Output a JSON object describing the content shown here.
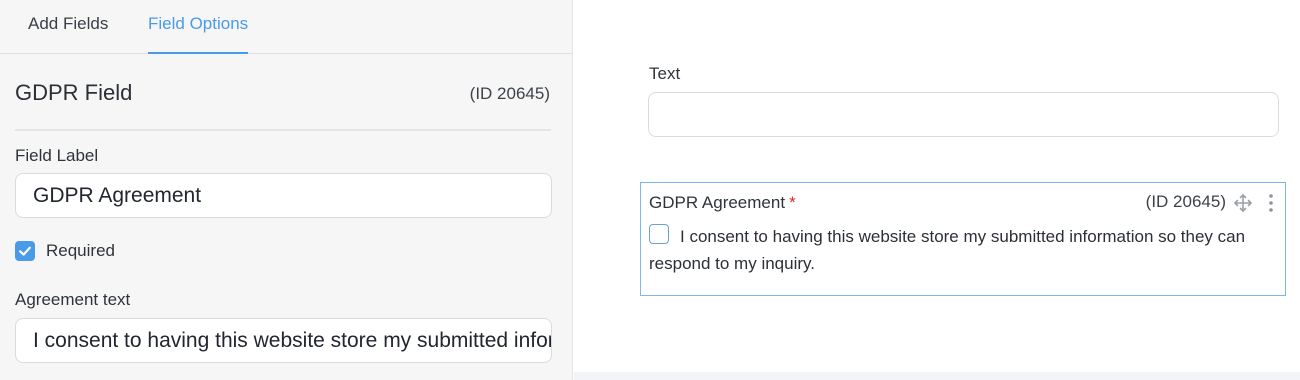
{
  "tabs": {
    "add_fields": "Add Fields",
    "field_options": "Field Options",
    "active_tab": "field_options"
  },
  "field_options": {
    "title": "GDPR Field",
    "id_text": "(ID 20645)",
    "field_label": {
      "label": "Field Label",
      "value": "GDPR Agreement"
    },
    "required": {
      "label": "Required",
      "checked": true
    },
    "agreement_text": {
      "label": "Agreement text",
      "value": "I consent to having this website store my submitted information so they can respond to my inquiry."
    }
  },
  "preview": {
    "text_field": {
      "label": "Text",
      "value": ""
    },
    "gdpr_field": {
      "label": "GDPR Agreement",
      "required_marker": "*",
      "id_text": "(ID 20645)",
      "consent_text": "I consent to having this website store my submitted information so they can respond to my inquiry.",
      "checked": false,
      "icons": [
        "move-icon",
        "kebab-menu-icon"
      ]
    }
  },
  "colors": {
    "accent": "#4a9be6",
    "required_asterisk": "#e0282a",
    "selected_border": "#7eb6ec",
    "sidebar_bg": "#f6f6f7"
  }
}
